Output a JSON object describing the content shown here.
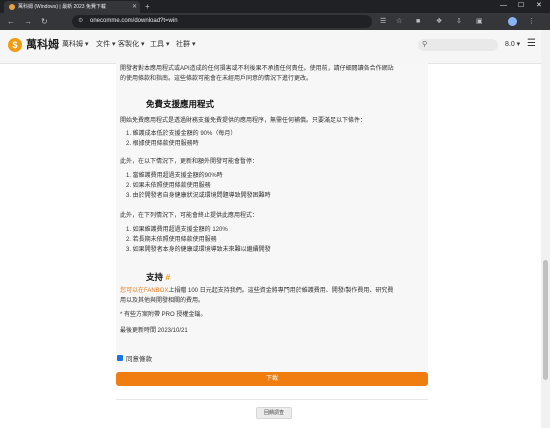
{
  "browser": {
    "tab_title": "萬科姆 (Windows) | 最新 2023 免費下載",
    "tab_close": "✕",
    "new_tab": "+",
    "url": "onecomme.com/download?t=win",
    "win_min": "—",
    "win_max": "☐",
    "win_close": "✕"
  },
  "site": {
    "logo_char": "$",
    "brand": "萬科姆",
    "menu": [
      "萬科姆 ▾",
      "文件 ▾",
      "客製化 ▾",
      "工具 ▾",
      "社群 ▾"
    ],
    "version": "8.0 ▾"
  },
  "content": {
    "intro": [
      "開發者對本應用程式或API造成的任何損害或不利後果不承擔任何責任。使用前，請仔細閱讀各合作網站",
      "的使用條款和指南。這些條款可能會在未經用戶同意的情況下進行更改。"
    ],
    "free_heading": "免費支援應用程式",
    "free_intro": "開始免費應用程式是透過財務支援免費提供的應用程序，無需任何補償。只要滿足以下條件：",
    "conditions": [
      "1. 維護成本低於支援金額的 90%（每月）",
      "2. 根據使用條款使用服務時"
    ],
    "suspend_intro": "此外，在以下情況下，更新和額外開發可能會暫停：",
    "suspend_list": [
      "1. 當維護費用超過支援金額的90%時",
      "2. 如果未依照使用條款使用服務",
      "3. 由於開發者自身健康狀況或環境問題導致開發困難時"
    ],
    "stop_intro": "此外，在下列情況下，可能會終止提供此應用程式：",
    "stop_list": [
      "1. 如果維護費用超過支援金額的 120%",
      "2. 若長期未依照使用條款使用服務",
      "3. 如果開發者本身的健康或環境導致未來難以繼續開發"
    ],
    "support_heading": "支持",
    "support_hash": "#",
    "support_link": "您可以在FANBOX",
    "support_text1": "上捐贈 100 日元起支持我們。這些資金將專門用於維護費用、開發/製作費用、研究費",
    "support_text2": "用以及其他與開發相關的費用。",
    "pro_note": "* 有些方案附帶 PRO 授權金鑰。",
    "updated": "最後更新時間 2023/10/21"
  },
  "actions": {
    "agree_label": "同意條款",
    "download_label": "下載",
    "feedback_label": "回饋調查"
  }
}
